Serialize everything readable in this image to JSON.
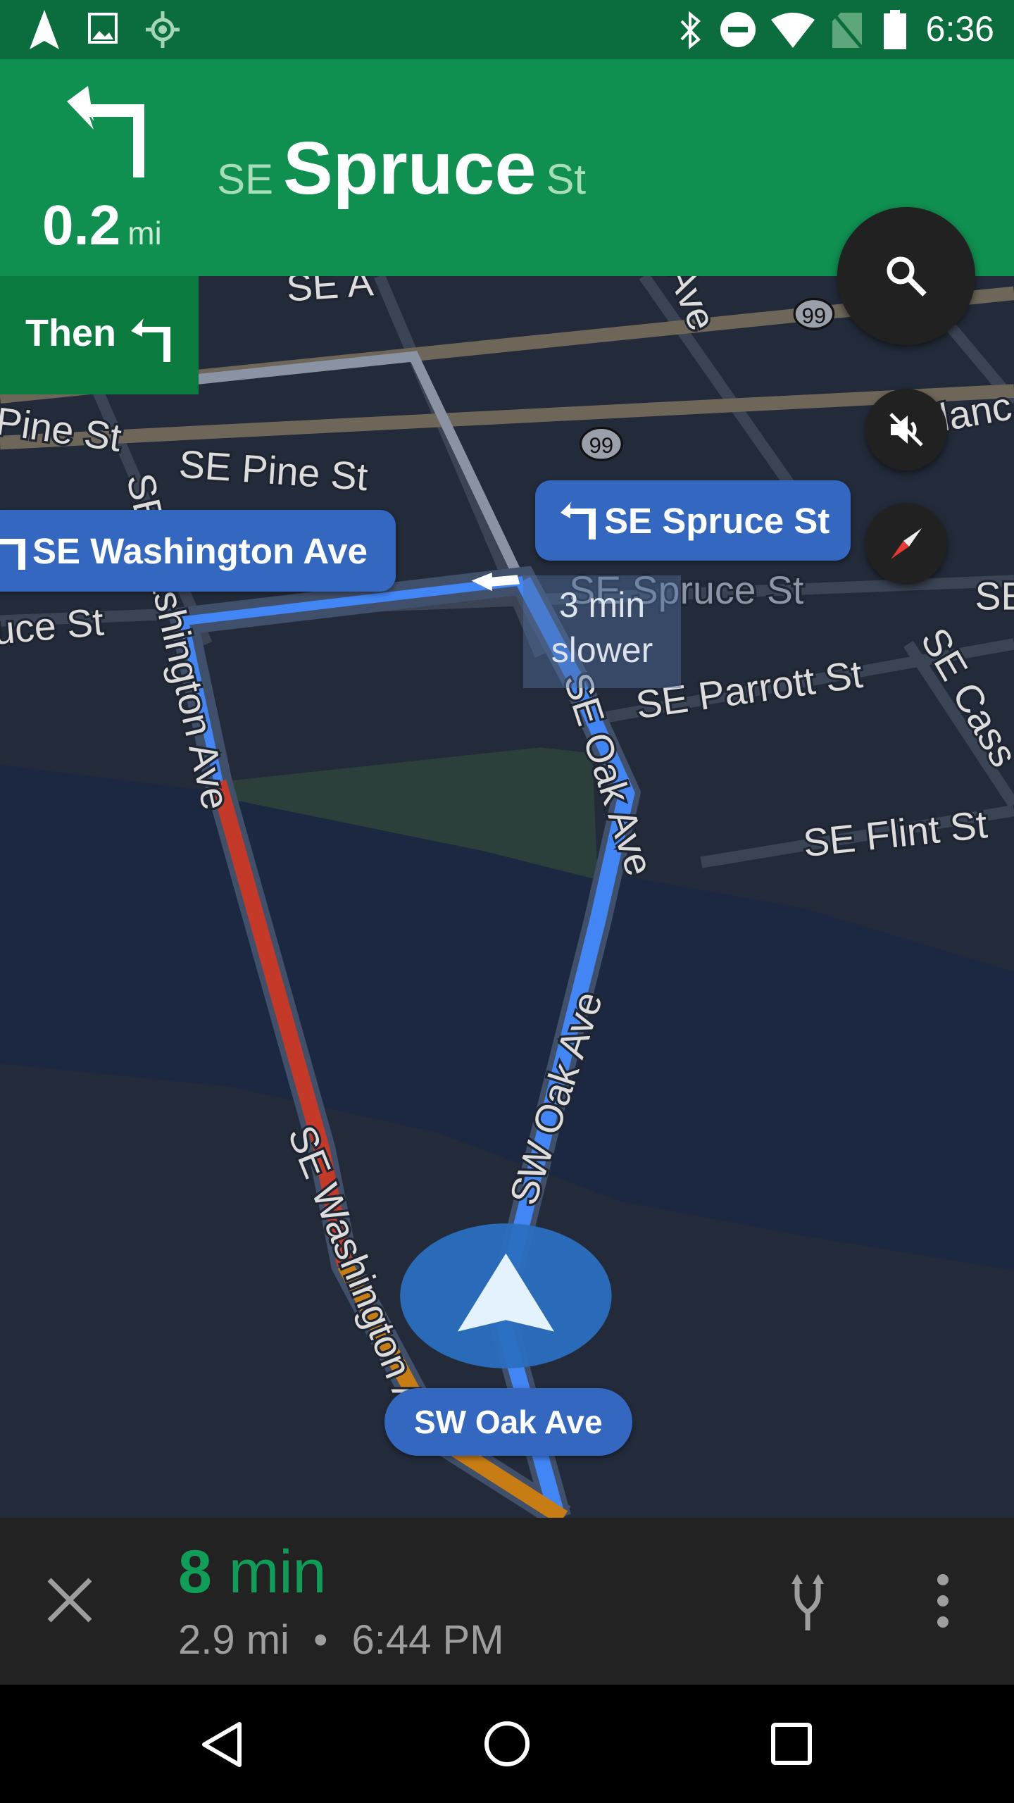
{
  "status_bar": {
    "time": "6:36",
    "left_icons": [
      "navigation-icon",
      "image-icon",
      "location-icon"
    ],
    "right_icons": [
      "bluetooth-icon",
      "do-not-disturb-icon",
      "wifi-icon",
      "no-sim-icon",
      "battery-icon"
    ]
  },
  "maneuver": {
    "distance_value": "0.2",
    "distance_unit": "mi",
    "street_prefix": "SE",
    "street_name": "Spruce",
    "street_suffix": "St",
    "icon": "turn-left-icon"
  },
  "then": {
    "label": "Then",
    "icon": "turn-left-icon"
  },
  "map": {
    "callouts": {
      "spruce": "SE Spruce St",
      "washington": "SE Washington Ave",
      "current_road": "SW Oak Ave"
    },
    "alternate_note": {
      "line1": "3 min",
      "line2": "slower"
    },
    "labels": {
      "pine1": "Pine St",
      "pine2": "SE Pine St",
      "spruce_left": "uce St",
      "spruce_right": "SE Spruce St",
      "parrott": "SE Parrott St",
      "flint": "SE Flint St",
      "cass": "SE Cass",
      "washington1": "SE Washington Ave",
      "washington2": "SE Washington Ave",
      "oak1": "SE Oak Ave",
      "oak2": "SW Oak Ave",
      "lanc": "lanc",
      "top1": "SE A",
      "top2": "Ave",
      "se_right": "SE"
    },
    "shields": [
      "99",
      "99"
    ],
    "colors": {
      "route": "#4285f4",
      "traffic_heavy": "#c53929",
      "traffic_medium": "#c77c14",
      "water": "#1c2742",
      "park": "#2c3f3b"
    }
  },
  "buttons": {
    "search": "search-icon",
    "mute": "volume-off-icon",
    "compass": "compass-icon"
  },
  "trip": {
    "duration_value": "8",
    "duration_unit": "min",
    "distance": "2.9 mi",
    "separator": "•",
    "arrival": "6:44 PM"
  },
  "colors": {
    "header_green": "#0f8f50",
    "status_green": "#0b6c3e",
    "eta_green": "#0f9d58"
  }
}
